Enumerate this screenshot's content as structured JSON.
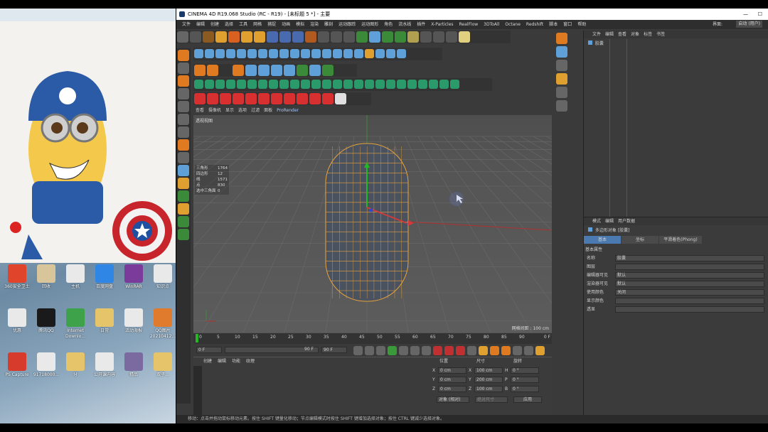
{
  "desktop": {
    "icons": [
      {
        "label": "360安全卫士",
        "color": "#e0452c"
      },
      {
        "label": "回收",
        "color": "#d8c59a"
      },
      {
        "label": "主机",
        "color": "#e9e9e9"
      },
      {
        "label": "百度网盘",
        "color": "#2f86e4"
      },
      {
        "label": "WinRAR",
        "color": "#7a3b9a"
      },
      {
        "label": "知识点",
        "color": "#e9e9e9"
      },
      {
        "label": "优惠",
        "color": "#e9e9e9"
      },
      {
        "label": "腾讯QQ",
        "color": "#1a1a1a"
      },
      {
        "label": "Internet Downlo...",
        "color": "#3da24a"
      },
      {
        "label": "日常",
        "color": "#e6c46a"
      },
      {
        "label": "活动海报",
        "color": "#e9e9e9"
      },
      {
        "label": "QQ图片 20210412...",
        "color": "#e07a2c"
      },
      {
        "label": "PS Capture",
        "color": "#d63b2c"
      },
      {
        "label": "91718000...",
        "color": "#e9e9e9"
      },
      {
        "label": "分",
        "color": "#e6c46a"
      },
      {
        "label": "公开课内容",
        "color": "#e9e9e9"
      },
      {
        "label": "精品",
        "color": "#7a6aa0"
      },
      {
        "label": "双子...",
        "color": "#e6c46a"
      }
    ]
  },
  "window": {
    "title": "CINEMA 4D R19.068 Studio (RC - R19) - [未标题 5 *] - 主要",
    "minimize": "—",
    "maximize": "☐"
  },
  "menu": [
    "文件",
    "编辑",
    "创建",
    "选择",
    "工具",
    "网格",
    "捕捉",
    "动画",
    "模拟",
    "渲染",
    "雕刻",
    "运动跟踪",
    "运动图形",
    "角色",
    "流水线",
    "插件",
    "X-Particles",
    "RealFlow",
    "3DToAll",
    "Octane",
    "Redshift",
    "脚本",
    "窗口",
    "帮助"
  ],
  "layout_label": "界面:",
  "layout_value": "启动 (用户)",
  "viewport": {
    "tabs": [
      "查看",
      "摄像机",
      "显示",
      "选项",
      "过滤",
      "面板",
      "ProRender"
    ],
    "camera_label": "透视视图",
    "stats": [
      {
        "k": "三角形",
        "v": "1764"
      },
      {
        "k": "四边形",
        "v": "12"
      },
      {
        "k": "线",
        "v": "1571"
      },
      {
        "k": "点",
        "v": "830"
      },
      {
        "k": "选中三角面",
        "v": "0"
      }
    ],
    "grid_spacing": "网格间距 : 100 cm"
  },
  "timeline": {
    "ticks": [
      "0",
      "5",
      "10",
      "15",
      "20",
      "25",
      "30",
      "35",
      "40",
      "45",
      "50",
      "55",
      "60",
      "65",
      "70",
      "75",
      "80",
      "85",
      "90"
    ],
    "end_frame": "0 F",
    "start_field": "0 F",
    "current_field": "0 F",
    "end_field": "90 F",
    "end_field2": "90 F"
  },
  "material": {
    "tabs": [
      "创建",
      "编辑",
      "功能",
      "纹理"
    ]
  },
  "coords": {
    "headers": [
      "位置",
      "尺寸",
      "旋转"
    ],
    "rows": [
      {
        "a": "X",
        "pos": "0 cm",
        "b": "X",
        "size": "100 cm",
        "c": "H",
        "rot": "0 °"
      },
      {
        "a": "Y",
        "pos": "0 cm",
        "b": "Y",
        "size": "200 cm",
        "c": "P",
        "rot": "0 °"
      },
      {
        "a": "Z",
        "pos": "0 cm",
        "b": "Z",
        "size": "100 cm",
        "c": "B",
        "rot": "0 °"
      }
    ],
    "mode": "对象 (相对)",
    "size_mode": "绝对尺寸",
    "apply": "应用"
  },
  "objmgr": {
    "tabs": [
      "文件",
      "编辑",
      "查看",
      "对象",
      "标签",
      "书签"
    ],
    "object": "胶囊"
  },
  "attrmgr": {
    "tabs": [
      "模式",
      "编辑",
      "用户数据"
    ],
    "object_title": "多边形对象 [胶囊]",
    "subtabs": [
      "基本",
      "坐标",
      "平滑着色(Phong)"
    ],
    "section": "基本属性",
    "fields": [
      {
        "k": "名称",
        "v": "胶囊"
      },
      {
        "k": "图层",
        "v": ""
      },
      {
        "k": "编辑器可见",
        "v": "默认"
      },
      {
        "k": "渲染器可见",
        "v": "默认"
      },
      {
        "k": "使用颜色",
        "v": "关闭"
      },
      {
        "k": "显示颜色",
        "v": ""
      },
      {
        "k": "透显",
        "v": ""
      }
    ]
  },
  "status": "移动：点击并拖动鼠标移动元素。按住 SHIFT 键量化移动；节点编辑模式时按住 SHIFT 键增加选择对象；按住 CTRL 键减少选择对象。",
  "colors": {
    "accent": "#4a7ab0",
    "mesh": "#e8a33a",
    "mesh_body": "#4a5260"
  }
}
